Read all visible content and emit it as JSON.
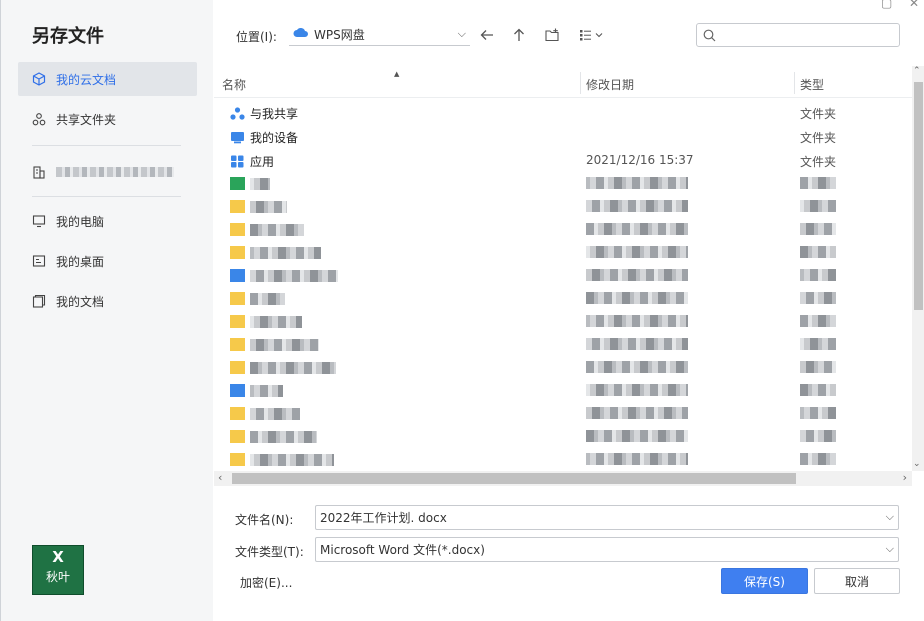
{
  "dialog": {
    "title": "另存文件"
  },
  "sidebar": {
    "items": [
      {
        "label": "我的云文档",
        "icon": "cube-icon",
        "active": true
      },
      {
        "label": "共享文件夹",
        "icon": "share-icon"
      },
      {
        "label": "",
        "icon": "building-icon",
        "blurred": true
      },
      {
        "label": "我的电脑",
        "icon": "monitor-icon"
      },
      {
        "label": "我的桌面",
        "icon": "desktop-icon"
      },
      {
        "label": "我的文档",
        "icon": "documents-icon"
      }
    ],
    "app_badge": {
      "top": "X",
      "label": "秋叶"
    }
  },
  "toolbar": {
    "location_label": "位置(I):",
    "location_value": "WPS网盘",
    "search_placeholder": ""
  },
  "file_list": {
    "columns": [
      "名称",
      "修改日期",
      "类型"
    ],
    "rows": [
      {
        "name": "与我共享",
        "date": "",
        "type": "文件夹",
        "icon": "shared-people-icon"
      },
      {
        "name": "我的设备",
        "date": "",
        "type": "文件夹",
        "icon": "device-icon"
      },
      {
        "name": "应用",
        "date": "2021/12/16 15:37",
        "type": "文件夹",
        "icon": "apps-grid-icon"
      }
    ],
    "blurred_rows": 13
  },
  "form": {
    "filename_label": "文件名(N):",
    "filename_value": "2022年工作计划. docx",
    "filetype_label": "文件类型(T):",
    "filetype_value": "Microsoft Word 文件(*.docx)",
    "encrypt_label": "加密(E)...",
    "save_label": "保存(S)",
    "cancel_label": "取消"
  },
  "colors": {
    "accent": "#3f7ff0",
    "folder": "#f6c94a",
    "blue_icon": "#3a86e8",
    "green_icon": "#2aa45a"
  }
}
